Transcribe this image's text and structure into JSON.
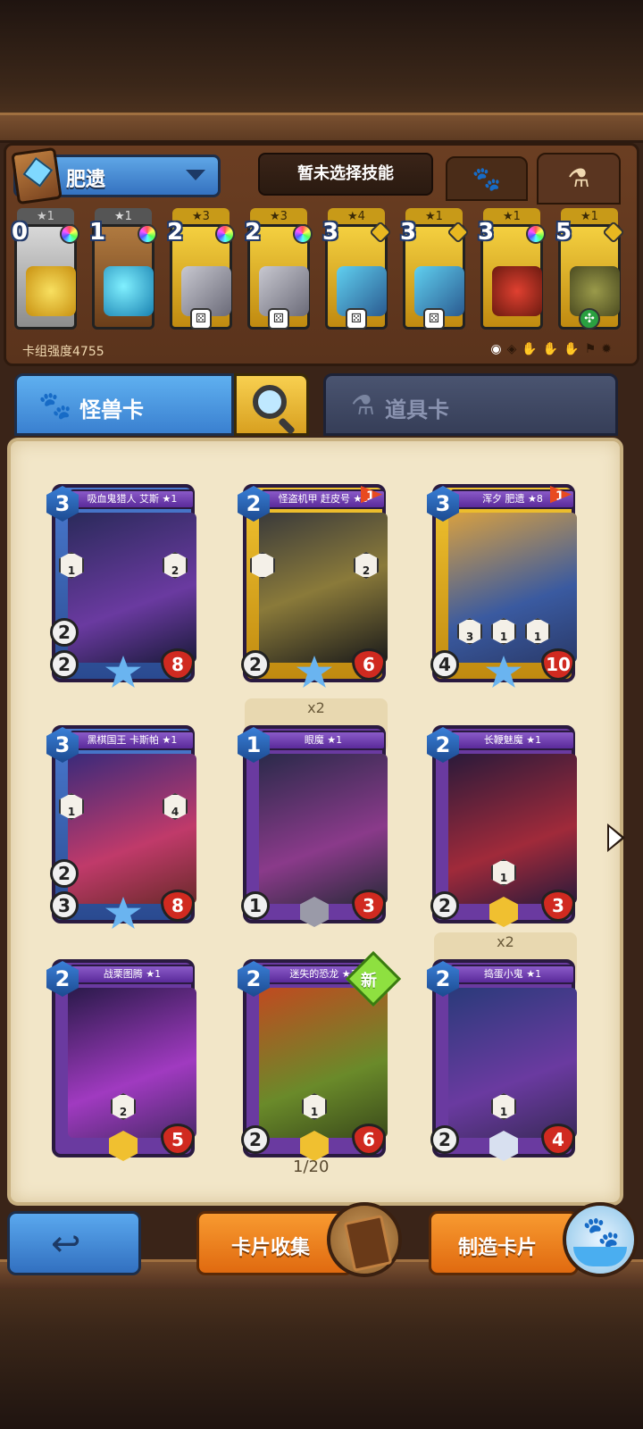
{
  "deck": {
    "name": "肥遗",
    "skill_label": "暂未选择技能",
    "power_label": "卡组强度4755",
    "tabs": [
      {
        "icon": "paw-icon",
        "label": ""
      },
      {
        "icon": "potion-icon",
        "label": ""
      }
    ],
    "cards": [
      {
        "stars": "★1",
        "cost": "0",
        "frame": "grey",
        "art": "gold-coin",
        "gem": "rainbow",
        "die": ""
      },
      {
        "stars": "★1",
        "cost": "1",
        "frame": "brown",
        "art": "blue-egg",
        "gem": "rainbow",
        "die": ""
      },
      {
        "stars": "★3",
        "cost": "2",
        "frame": "gold",
        "art": "trap",
        "gem": "rainbow",
        "die": "⚄"
      },
      {
        "stars": "★3",
        "cost": "2",
        "frame": "gold",
        "art": "trap",
        "gem": "rainbow",
        "die": "⚄"
      },
      {
        "stars": "★4",
        "cost": "3",
        "frame": "gold",
        "art": "blue-blades",
        "gem": "gold",
        "die": "⚄"
      },
      {
        "stars": "★1",
        "cost": "3",
        "frame": "gold",
        "art": "blue-blades",
        "gem": "gold",
        "die": "⚄"
      },
      {
        "stars": "★1",
        "cost": "3",
        "frame": "gold",
        "art": "demon-mask",
        "gem": "rainbow",
        "die": ""
      },
      {
        "stars": "★1",
        "cost": "5",
        "frame": "gold",
        "art": "green-beast",
        "gem": "gold",
        "die": "✣"
      }
    ],
    "filters": [
      "◉",
      "◈",
      "✋",
      "✋",
      "✋",
      "⚑",
      "✹"
    ]
  },
  "tabs": {
    "monster": "怪兽卡",
    "item": "道具卡"
  },
  "cards": [
    {
      "name": "吸血鬼猎人 艾斯 ★1",
      "cost": "3",
      "atk": "2",
      "def": "2",
      "hp": "8",
      "frame": "blue",
      "rank": "star",
      "flag": "",
      "copies": "",
      "new": false,
      "abilities": [
        "1",
        "2"
      ]
    },
    {
      "name": "怪盗机甲 赶皮号 ★3",
      "cost": "2",
      "atk": "",
      "def": "2",
      "hp": "6",
      "frame": "gold",
      "rank": "star",
      "flag": "1",
      "copies": "",
      "new": false,
      "abilities": [
        "",
        "2"
      ]
    },
    {
      "name": "浑夕 肥遗 ★8",
      "cost": "3",
      "atk": "",
      "def": "4",
      "hp": "10",
      "frame": "gold",
      "rank": "star",
      "flag": "1",
      "copies": "",
      "new": false,
      "abilities": [
        "3",
        "1",
        "1"
      ]
    },
    {
      "name": "黑棋国王 卡斯帕 ★1",
      "cost": "3",
      "atk": "2",
      "def": "3",
      "hp": "8",
      "frame": "blue",
      "rank": "star",
      "flag": "",
      "copies": "",
      "new": false,
      "abilities": [
        "1",
        "4"
      ]
    },
    {
      "name": "眼魔 ★1",
      "cost": "1",
      "atk": "",
      "def": "1",
      "hp": "3",
      "frame": "purple",
      "rank": "grey",
      "flag": "",
      "copies": "x2",
      "new": false,
      "abilities": []
    },
    {
      "name": "长鞭魅魔 ★1",
      "cost": "2",
      "atk": "",
      "def": "2",
      "hp": "3",
      "frame": "purple",
      "rank": "gold",
      "flag": "",
      "copies": "",
      "new": false,
      "abilities": [
        "1"
      ]
    },
    {
      "name": "战栗图腾 ★1",
      "cost": "2",
      "atk": "",
      "def": "",
      "hp": "5",
      "frame": "purple",
      "rank": "gold",
      "flag": "",
      "copies": "",
      "new": false,
      "abilities": [
        "2"
      ]
    },
    {
      "name": "迷失的恐龙 ★1",
      "cost": "2",
      "atk": "",
      "def": "2",
      "hp": "6",
      "frame": "purple",
      "rank": "gold",
      "flag": "",
      "copies": "",
      "new": true,
      "new_label": "新",
      "abilities": [
        "1"
      ]
    },
    {
      "name": "捣蛋小鬼 ★1",
      "cost": "2",
      "atk": "",
      "def": "2",
      "hp": "4",
      "frame": "purple",
      "rank": "silver",
      "flag": "",
      "copies": "x2",
      "new": false,
      "abilities": [
        "1"
      ]
    }
  ],
  "pagination": "1/20",
  "buttons": {
    "back": "↩",
    "collect": "卡片收集",
    "craft": "制造卡片"
  },
  "colors": {
    "blue_tab": "#3a80d0",
    "orange_button": "#e06a10",
    "book_page": "#f2e6c8",
    "card_purple": "#6a3aa0",
    "card_gold": "#c08a10"
  }
}
